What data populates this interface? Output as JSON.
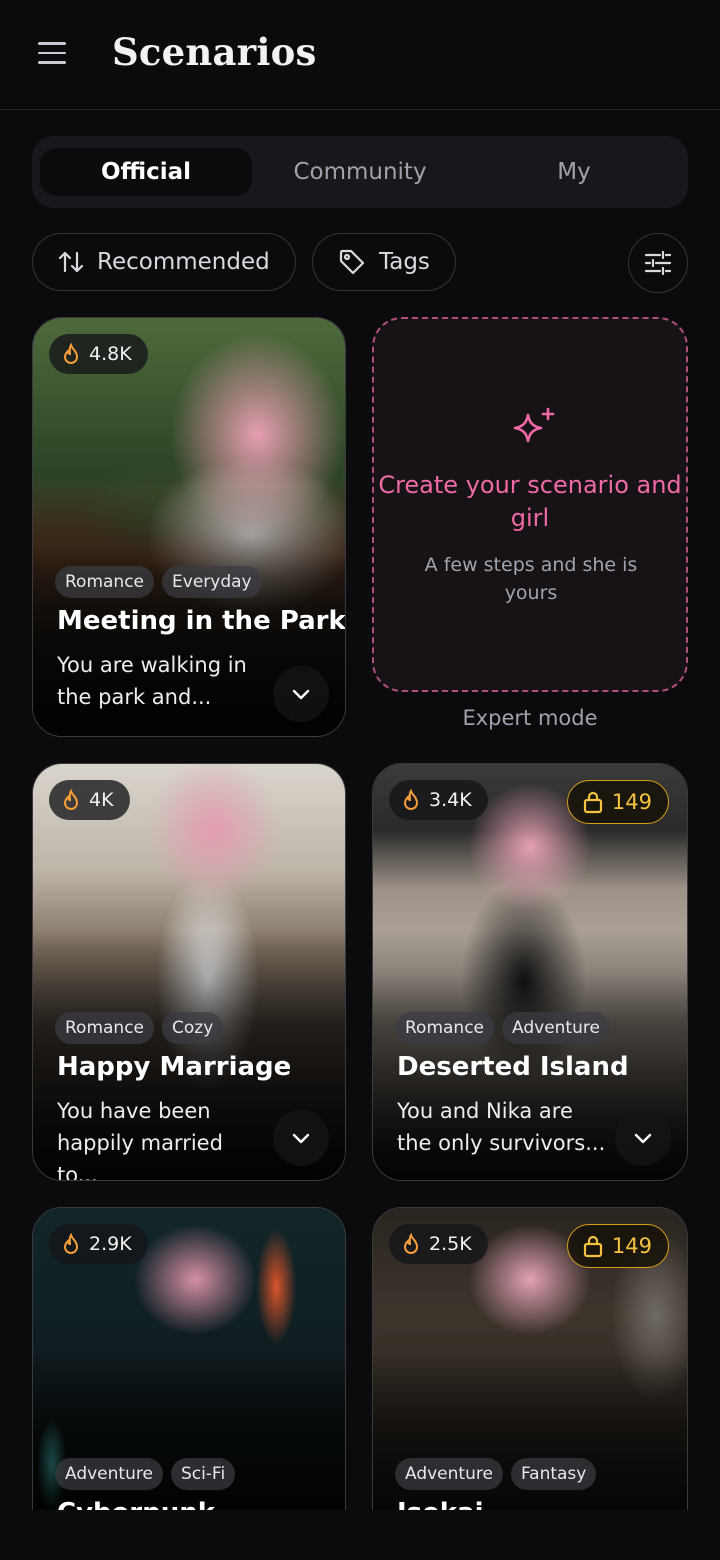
{
  "header": {
    "title": "Scenarios",
    "menu_icon": "hamburger-menu-icon"
  },
  "tabs": [
    {
      "label": "Official",
      "active": true
    },
    {
      "label": "Community",
      "active": false
    },
    {
      "label": "My",
      "active": false
    }
  ],
  "filters": {
    "sort_label": "Recommended",
    "sort_icon": "sort-arrows-icon",
    "tags_label": "Tags",
    "tags_icon": "tag-icon",
    "settings_icon": "sliders-icon"
  },
  "create": {
    "title": "Create your scenario and girl",
    "subtitle": "A few steps and she is yours",
    "expert_link": "Expert mode",
    "icon": "sparkles-icon",
    "accent": "#ee6aa6"
  },
  "cards": [
    {
      "views": "4.8K",
      "price": null,
      "tags": [
        "Romance",
        "Everyday"
      ],
      "title": "Meeting in the Park",
      "desc": "You are walking in the park and..."
    },
    {
      "views": "4K",
      "price": null,
      "tags": [
        "Romance",
        "Cozy"
      ],
      "title": "Happy Marriage",
      "desc": "You have been happily married to..."
    },
    {
      "views": "3.4K",
      "price": "149",
      "tags": [
        "Romance",
        "Adventure"
      ],
      "title": "Deserted Island",
      "desc": "You and Nika are the only survivors..."
    },
    {
      "views": "2.9K",
      "price": null,
      "tags": [
        "Adventure",
        "Sci-Fi"
      ],
      "title": "Cyberpunk",
      "desc": ""
    },
    {
      "views": "2.5K",
      "price": "149",
      "tags": [
        "Adventure",
        "Fantasy"
      ],
      "title": "Isekai",
      "desc": ""
    }
  ],
  "colors": {
    "background": "#0b0b0e",
    "price_gold": "#f5c242",
    "views_flame": "#f59e3a"
  }
}
